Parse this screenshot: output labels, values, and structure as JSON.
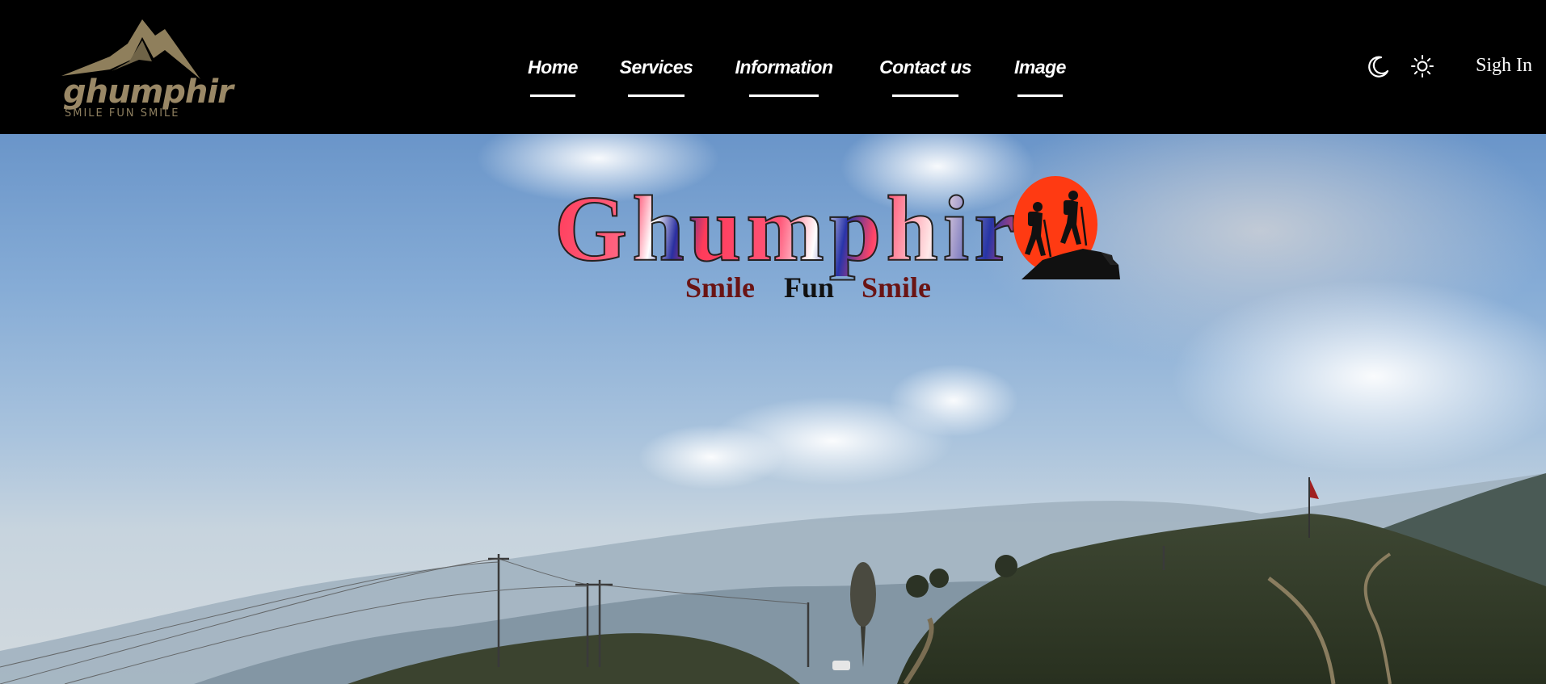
{
  "header": {
    "logo": {
      "wordmark": "ghumphir",
      "tagline": "SMILE FUN SMILE",
      "colors": {
        "mountain": "#8f7f5c",
        "text": "#9a8866"
      }
    },
    "nav": [
      {
        "label": "Home"
      },
      {
        "label": "Services"
      },
      {
        "label": "Information"
      },
      {
        "label": "Contact us"
      },
      {
        "label": "Image"
      }
    ],
    "theme_toggle": {
      "dark_icon": "moon-icon",
      "light_icon": "sun-icon"
    },
    "signin_label": "Sigh In",
    "background": "#000000"
  },
  "hero": {
    "title": "Ghumphir",
    "subtitle_words": [
      "Smile",
      "Fun",
      "Smile"
    ],
    "badge_icon": "hikers-on-sunset-icon",
    "colors": {
      "badge_sun": "#ff3a12",
      "title_red": "#ff3b5a",
      "title_blue": "#2a2fa0"
    }
  }
}
